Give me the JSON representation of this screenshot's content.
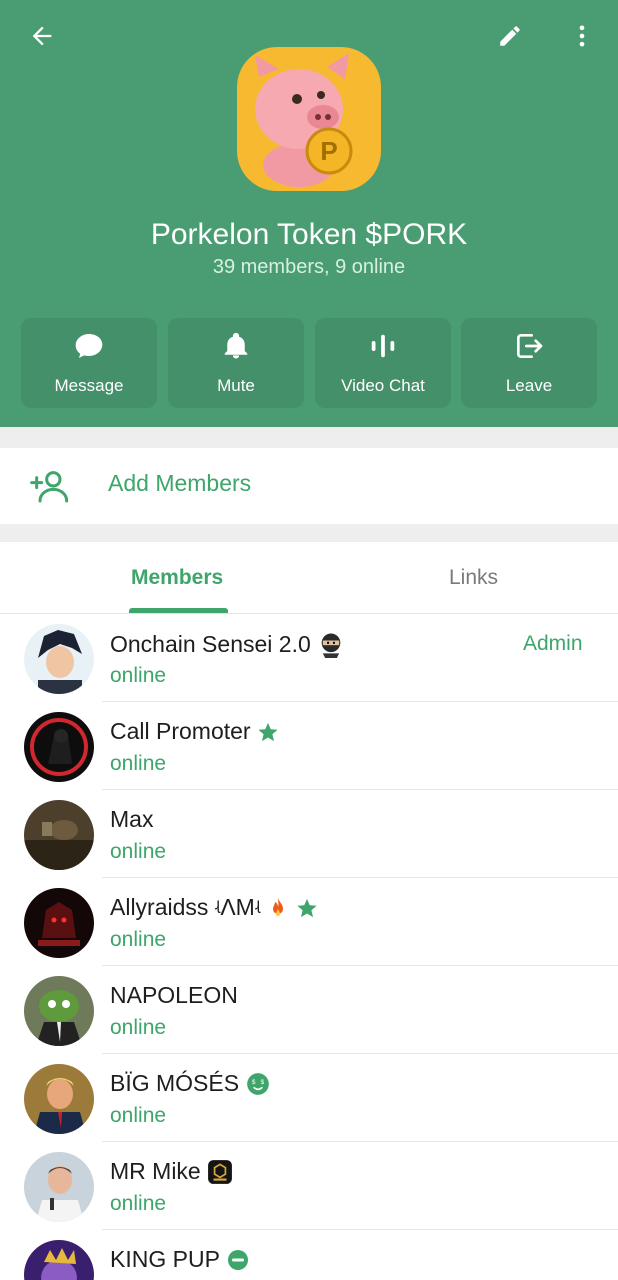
{
  "header": {
    "title": "Porkelon Token $PORK",
    "subtitle": "39 members, 9 online",
    "avatar_coin_letter": "P",
    "background_color": "#4a9d73"
  },
  "actions": [
    {
      "label": "Message",
      "icon": "chat-bubble-icon"
    },
    {
      "label": "Mute",
      "icon": "bell-icon"
    },
    {
      "label": "Video Chat",
      "icon": "sound-bars-icon"
    },
    {
      "label": "Leave",
      "icon": "exit-icon"
    }
  ],
  "add_members": {
    "label": "Add Members",
    "icon": "add-person-icon"
  },
  "tabs": [
    {
      "label": "Members",
      "active": true
    },
    {
      "label": "Links",
      "active": false
    }
  ],
  "members": [
    {
      "name": "Onchain Sensei 2.0",
      "status": "online",
      "role": "Admin",
      "badge": "ninja-emoji"
    },
    {
      "name": "Call Promoter",
      "status": "online",
      "role": "",
      "badge": "star-icon"
    },
    {
      "name": "Max",
      "status": "online",
      "role": "",
      "badge": ""
    },
    {
      "name": "Allyraidss ʵΛMʵ",
      "status": "online",
      "role": "",
      "badge": "fire-emoji star-icon"
    },
    {
      "name": "NAPOLEON",
      "status": "online",
      "role": "",
      "badge": ""
    },
    {
      "name": "BÏG MÓSÉS",
      "status": "online",
      "role": "",
      "badge": "money-face-emoji"
    },
    {
      "name": "MR Mike",
      "status": "online",
      "role": "",
      "badge": "app-logo-emoji"
    },
    {
      "name": "KING PUP",
      "status": "",
      "role": "",
      "badge": "minus-circle-icon"
    }
  ],
  "colors": {
    "accent": "#3ea56b",
    "header": "#4a9d73",
    "action_button": "#43906a"
  }
}
